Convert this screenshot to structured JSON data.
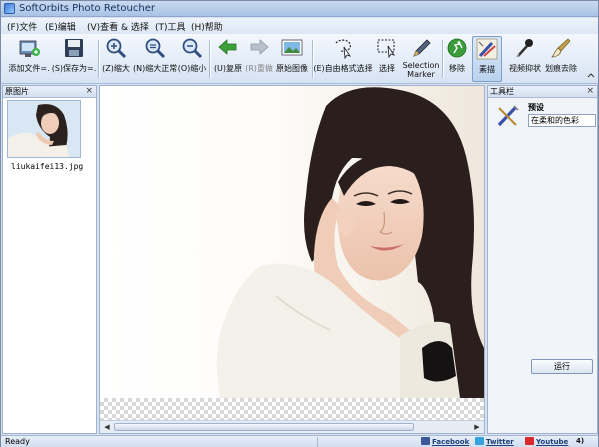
{
  "window": {
    "title": "SoftOrbits Photo Retoucher"
  },
  "menu": [
    {
      "label": "(F)文件"
    },
    {
      "label": "(E)编辑"
    },
    {
      "label": "(V)查看"
    },
    {
      "label": "& 选择"
    },
    {
      "label": "(T)工具"
    },
    {
      "label": "(H)帮助"
    }
  ],
  "toolbar": {
    "add_file": "添加文件=.",
    "save_as": "(S)保存为=.",
    "zoom_in": "(Z)缩大",
    "zoom_normal": "(N)缩大正常",
    "zoom_out": "(O)缩小",
    "undo": "(U)复原",
    "redo": "(R)重做",
    "original": "原始图像",
    "free_select": "(E)自由格式选择",
    "select": "选择",
    "selection_marker_1": "Selection",
    "selection_marker_2": "Marker",
    "remove": "移除",
    "sketch": "素描",
    "video_stamp": "视频抑状",
    "stain_remove": "划痕去除"
  },
  "left_panel": {
    "title": "原图片",
    "thumbnail_caption": "liukaifei13.jpg"
  },
  "right_panel": {
    "title": "工具栏",
    "preset_label": "预设",
    "preset_value": "在柔和的色彩",
    "run_button": "运行"
  },
  "status": {
    "ready": "Ready",
    "facebook": "Facebook",
    "twitter": "Twitter",
    "youtube": "Youtube",
    "extra": "4)"
  },
  "colors": {
    "facebook": "#3b5998",
    "twitter": "#33a3e0",
    "youtube": "#d92b2b"
  }
}
